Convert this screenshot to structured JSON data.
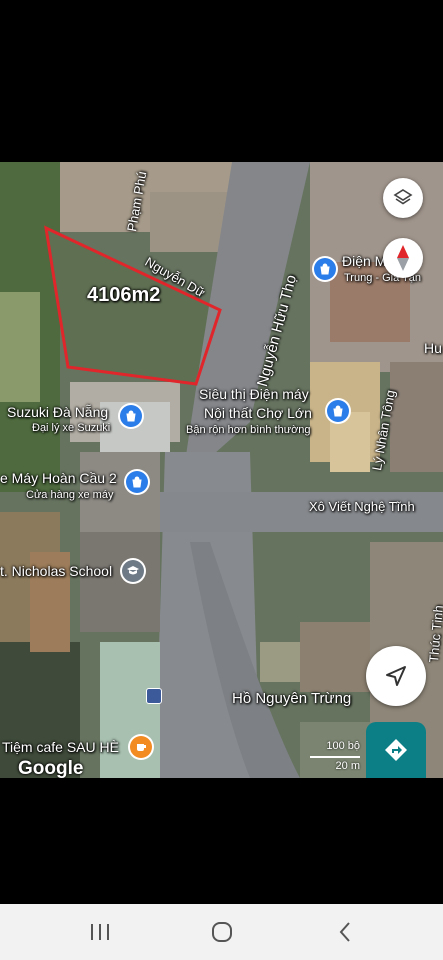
{
  "colors": {
    "plot_outline": "#e0262b",
    "pin_blue": "#2b7de9",
    "pin_orange": "#f28b22",
    "pin_gray": "#6e7a86",
    "directions_teal": "#0b7f85"
  },
  "plot": {
    "area_label": "4106m2"
  },
  "streets": {
    "pham_phu": "Phạm Phú",
    "nguyen_du": "Nguyễn Dữ",
    "nguyen_huu_tho": "Nguyễn Hữu Thọ",
    "xo_viet_nghe_tinh": "Xô Viết Nghệ Tĩnh",
    "ly_nhan_tong": "Lý Nhân Tông",
    "thuc_tinh": "Thúc Tịnh",
    "ho_nguyen_trung": "Hồ Nguyên Trừng"
  },
  "places": {
    "dien_may": {
      "name": "Điện M",
      "name_cont": "Trung - Gia Tặn",
      "partial_right": "Hu"
    },
    "sieu_thi": {
      "line1": "Siêu thị Điện máy",
      "line2": "Nội thất Chợ Lớn",
      "sub": "Bận rộn hơn bình thường"
    },
    "suzuki": {
      "name": "Suzuki Đà Nẵng",
      "sub": "Đại lý xe Suzuki"
    },
    "hoan_cau": {
      "name": "e Máy Hoàn Cầu 2",
      "sub": "Cửa hàng xe máy"
    },
    "nicholas": {
      "name": "t. Nicholas School"
    },
    "cafe": {
      "name": "Tiệm cafe SAU HÈ"
    }
  },
  "map_ui": {
    "brand": "Google",
    "scale_ft": "100 bộ",
    "scale_m": "20 m",
    "icons": [
      "layers-icon",
      "compass-icon",
      "my-location-icon",
      "directions-icon"
    ]
  },
  "system_nav": {
    "icons": [
      "recents-icon",
      "home-icon",
      "back-icon"
    ]
  }
}
